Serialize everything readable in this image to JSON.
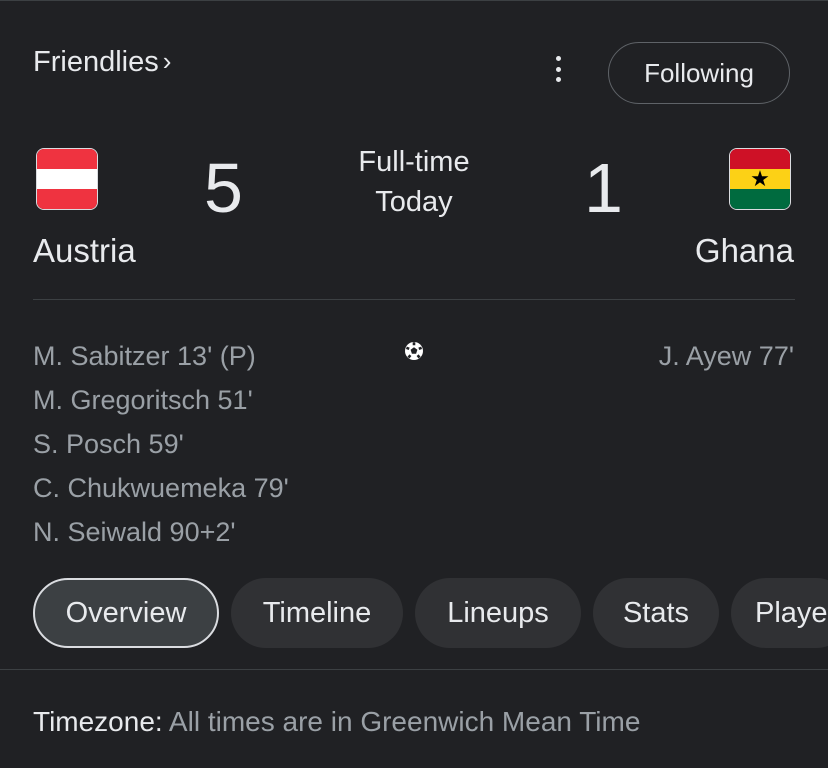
{
  "header": {
    "competition": "Friendlies",
    "competition_chevron": "›",
    "menu_icon": "more-vert-icon",
    "follow_label": "Following"
  },
  "match": {
    "status": "Full-time",
    "date": "Today",
    "home": {
      "name": "Austria",
      "score": "5",
      "flag_colors": [
        "#ef3340",
        "#ffffff",
        "#ef3340"
      ],
      "scorers": [
        "M. Sabitzer 13' (P)",
        "M. Gregoritsch 51'",
        "S. Posch 59'",
        "C. Chukwuemeka 79'",
        "N. Seiwald 90+2'"
      ]
    },
    "away": {
      "name": "Ghana",
      "score": "1",
      "flag_colors": [
        "#ce1126",
        "#fcd116",
        "#006b3f"
      ],
      "flag_star": "★",
      "scorers": [
        "J. Ayew 77'"
      ]
    },
    "goal_icon": "soccer-ball-icon"
  },
  "tabs": [
    {
      "label": "Overview",
      "active": true
    },
    {
      "label": "Timeline",
      "active": false
    },
    {
      "label": "Lineups",
      "active": false
    },
    {
      "label": "Stats",
      "active": false
    },
    {
      "label": "Playe",
      "active": false
    }
  ],
  "footer": {
    "timezone_label": "Timezone:",
    "timezone_text": "All times are in Greenwich Mean Time"
  }
}
